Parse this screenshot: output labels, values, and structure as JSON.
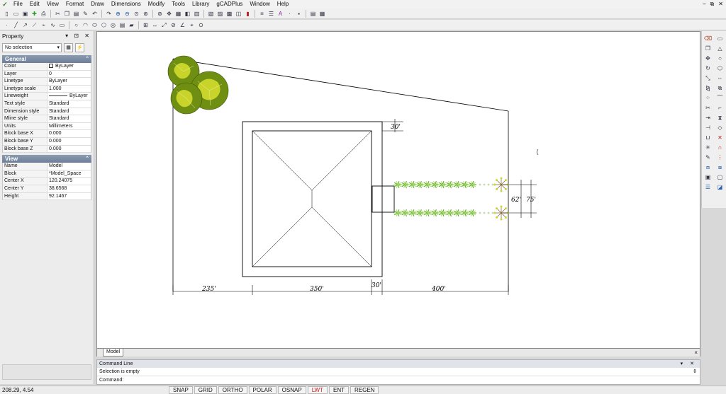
{
  "menu": {
    "items": [
      "File",
      "Edit",
      "View",
      "Format",
      "Draw",
      "Dimensions",
      "Modify",
      "Tools",
      "Library",
      "gCADPlus",
      "Window",
      "Help"
    ],
    "window_controls": [
      "–",
      "⧉",
      "✕"
    ]
  },
  "toolbar1": {
    "icons": [
      "new-icon",
      "open-icon",
      "save-icon",
      "add-icon",
      "print-icon",
      "cut-icon",
      "copy-icon",
      "paste-icon",
      "match-icon",
      "undo-icon",
      "redo-icon",
      "zoom-in-icon",
      "zoom-out-icon",
      "zoom-window-icon",
      "zoom-all-icon",
      "zoom-extents-icon",
      "pan-icon",
      "properties-icon",
      "layers-icon",
      "block-icon",
      "library-icon",
      "layer-manager-icon",
      "text-style-icon",
      "dim-style-icon",
      "color-icon",
      "linetype-icon",
      "lineweight-icon",
      "text-icon",
      "point-icon",
      "image-icon",
      "hatch-icon",
      "table-icon"
    ]
  },
  "toolbar2": {
    "icons": [
      "point-icon",
      "line-icon",
      "ray-icon",
      "construction-line-icon",
      "polyline-icon",
      "spline-icon",
      "rectangle-icon",
      "circle-icon",
      "arc-icon",
      "ellipse-icon",
      "polygon-icon",
      "donut-icon",
      "hatch-icon",
      "region-icon",
      "block-insert-icon",
      "dimension-linear-icon",
      "dimension-aligned-icon",
      "dimension-radius-icon",
      "dimension-angular-icon",
      "snap-settings-icon",
      "tangent-icon"
    ]
  },
  "property": {
    "title": "Property",
    "panel_controls": [
      "▾",
      "⊡",
      "✕"
    ],
    "selection": "No selection",
    "general_header": "General",
    "general": [
      {
        "k": "Color",
        "v": "ByLayer"
      },
      {
        "k": "Layer",
        "v": "0"
      },
      {
        "k": "Linetype",
        "v": "ByLayer"
      },
      {
        "k": "Linetype scale",
        "v": "1.000"
      },
      {
        "k": "Lineweight",
        "v": "ByLayer"
      },
      {
        "k": "Text style",
        "v": "Standard"
      },
      {
        "k": "Dimension style",
        "v": "Standard"
      },
      {
        "k": "Mline style",
        "v": "Standard"
      },
      {
        "k": "Units",
        "v": "Millimeters"
      },
      {
        "k": "Block base X",
        "v": "0.000"
      },
      {
        "k": "Block base Y",
        "v": "0.000"
      },
      {
        "k": "Block base Z",
        "v": "0.000"
      }
    ],
    "view_header": "View",
    "view": [
      {
        "k": "Name",
        "v": "Model"
      },
      {
        "k": "Block",
        "v": "*Model_Space"
      },
      {
        "k": "Center X",
        "v": "120.24075"
      },
      {
        "k": "Center Y",
        "v": "38.6568"
      },
      {
        "k": "Height",
        "v": "92.1467"
      }
    ]
  },
  "drawing": {
    "dimensions": {
      "d_235": "235'",
      "d_350": "350'",
      "d_30_bottom": "30'",
      "d_400": "400'",
      "d_30_top": "30'",
      "d_62": "62'",
      "d_75": "75'"
    },
    "colors": {
      "tree_dark": "#6f8f12",
      "tree_light": "#c9d42a",
      "hedge": "#5fae2a",
      "hedge_light": "#b6e07a"
    }
  },
  "tabs": {
    "model": "Model",
    "close": "×"
  },
  "command": {
    "title": "Command Line",
    "controls": [
      "▾",
      "✕"
    ],
    "history": "Selection is empty",
    "prompt": "Command:"
  },
  "right_toolbar": {
    "icons": [
      "erase-icon",
      "rectangle-icon",
      "copy-icon",
      "triangle-icon",
      "move-icon",
      "circle-icon",
      "rotate-icon",
      "polygon-icon",
      "scale-icon",
      "stretch-icon",
      "mirror-icon",
      "offset-icon",
      "array-icon",
      "fillet-icon",
      "trim-icon",
      "chamfer-icon",
      "extend-icon",
      "hourglass-icon",
      "break-icon",
      "diamond-icon",
      "join-icon",
      "cross-icon",
      "explode-icon",
      "magnet-icon",
      "edit-polyline-icon",
      "grid-icon",
      "bring-front-icon",
      "send-back-icon",
      "group-icon",
      "ungroup-icon",
      "stack-icon",
      "layer-icon"
    ]
  },
  "status": {
    "coords": "208.29,  4.54",
    "buttons": [
      {
        "label": "SNAP",
        "on": true
      },
      {
        "label": "GRID",
        "on": true
      },
      {
        "label": "ORTHO",
        "on": true
      },
      {
        "label": "POLAR",
        "on": true
      },
      {
        "label": "OSNAP",
        "on": true
      },
      {
        "label": "LWT",
        "on": false
      },
      {
        "label": "ENT",
        "on": true
      },
      {
        "label": "REGEN",
        "on": true
      }
    ]
  }
}
